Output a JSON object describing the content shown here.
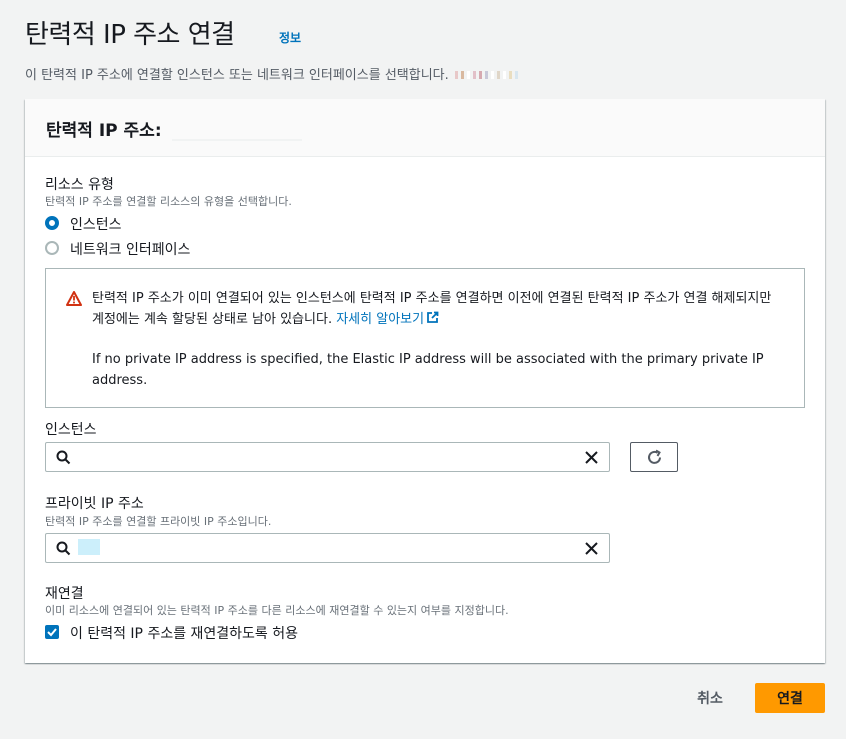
{
  "page": {
    "title": "탄력적 IP 주소 연결",
    "info_link": "정보",
    "description": "이 탄력적 IP 주소에 연결할 인스턴스 또는 네트워크 인터페이스를 선택합니다."
  },
  "panel": {
    "title": "탄력적 IP 주소:"
  },
  "resource_type": {
    "label": "리소스 유형",
    "description": "탄력적 IP 주소를 연결할 리소스의 유형을 선택합니다.",
    "options": [
      {
        "label": "인스턴스",
        "selected": true
      },
      {
        "label": "네트워크 인터페이스",
        "selected": false
      }
    ]
  },
  "alert": {
    "text": "탄력적 IP 주소가 이미 연결되어 있는 인스턴스에 탄력적 IP 주소를 연결하면 이전에 연결된 탄력적 IP 주소가 연결 해제되지만 계정에는 계속 할당된 상태로 남아 있습니다.",
    "link": "자세히 알아보기",
    "text_en": "If no private IP address is specified, the Elastic IP address will be associated with the primary private IP address."
  },
  "instance": {
    "label": "인스턴스",
    "value": ""
  },
  "private_ip": {
    "label": "프라이빗 IP 주소",
    "description": "탄력적 IP 주소를 연결할 프라이빗 IP 주소입니다.",
    "value": ""
  },
  "reassociation": {
    "label": "재연결",
    "description": "이미 리소스에 연결되어 있는 탄력적 IP 주소를 다른 리소스에 재연결할 수 있는지 여부를 지정합니다.",
    "checkbox_label": "이 탄력적 IP 주소를 재연결하도록 허용",
    "checked": true
  },
  "footer": {
    "cancel_label": "취소",
    "submit_label": "연결"
  },
  "colors": {
    "accent": "#0073bb",
    "primary_button": "#ff9900",
    "warning": "#d13212"
  }
}
